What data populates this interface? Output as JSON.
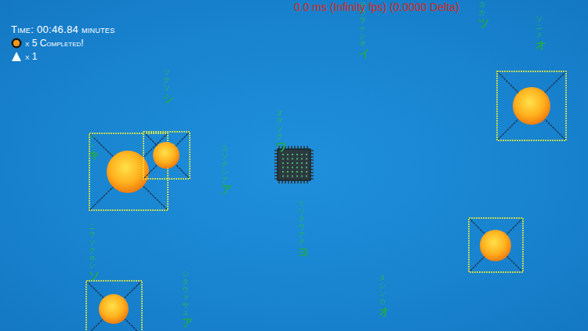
{
  "debug": "0.0 ms (Infinity fps) (0.0000 Delta)",
  "hud": {
    "time": "Time: 00:46.84 minutes",
    "completed": "x 5 Completed!",
    "lives": "x 1"
  },
  "rain": [
    {
      "text": "ヨウヲャシオイ"
    },
    {
      "text": "ヨカツ"
    },
    {
      "text": "ソニメオ"
    },
    {
      "text": "ツクソシ"
    },
    {
      "text": "ヌヲソクワ"
    },
    {
      "text": "ユソクシアア"
    },
    {
      "text": "ャシキ"
    },
    {
      "text": "ミソクウアクヨ"
    },
    {
      "text": "ニヲソクヰシソ"
    },
    {
      "text": "シタウァサュア"
    },
    {
      "text": "ヌシンカオ"
    }
  ]
}
